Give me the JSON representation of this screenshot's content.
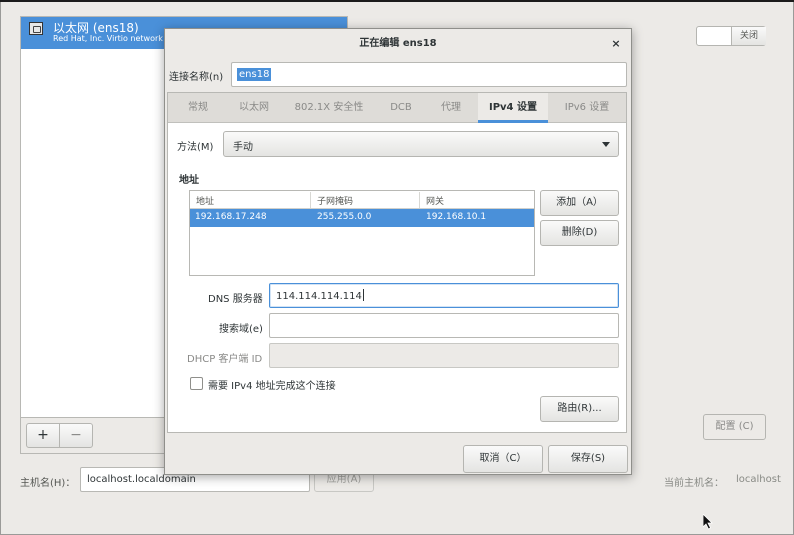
{
  "background": {
    "connection": {
      "name": "以太网 (ens18)",
      "description": "Red Hat, Inc. Virtio network d"
    },
    "list_buttons": {
      "add": "+",
      "remove": "−"
    },
    "hostname_label": "主机名(H)：",
    "hostname_value": "localhost.localdomain",
    "apply_label": "应用(A)",
    "toggle_off_label": "关闭",
    "config_label": "配置 (C)",
    "current_host_label": "当前主机名：",
    "current_host_value": "localhost"
  },
  "dialog": {
    "title": "正在编辑 ens18",
    "close": "×",
    "name_label": "连接名称(n)",
    "name_value": "ens18",
    "tabs": [
      {
        "label": "常规"
      },
      {
        "label": "以太网"
      },
      {
        "label": "802.1X 安全性"
      },
      {
        "label": "DCB"
      },
      {
        "label": "代理"
      },
      {
        "label": "IPv4 设置"
      },
      {
        "label": "IPv6 设置"
      }
    ],
    "ipv4": {
      "method_label": "方法(M)",
      "method_value": "手动",
      "address_heading": "地址",
      "columns": [
        "地址",
        "子网掩码",
        "网关"
      ],
      "rows": [
        {
          "address": "192.168.17.248",
          "netmask": "255.255.0.0",
          "gateway": "192.168.10.1"
        }
      ],
      "add_label": "添加（A）",
      "delete_label": "删除(D)",
      "dns_label": "DNS 服务器",
      "dns_value": "114.114.114.114",
      "search_label": "搜索域(e)",
      "search_value": "",
      "dhcp_label": "DHCP 客户端 ID",
      "dhcp_value": "",
      "require_label": "需要 IPv4 地址完成这个连接",
      "routes_label": "路由(R)..."
    },
    "cancel_label": "取消（C）",
    "save_label": "保存(S)"
  },
  "colors": {
    "accent": "#4a90d9",
    "background": "#eceae7"
  }
}
